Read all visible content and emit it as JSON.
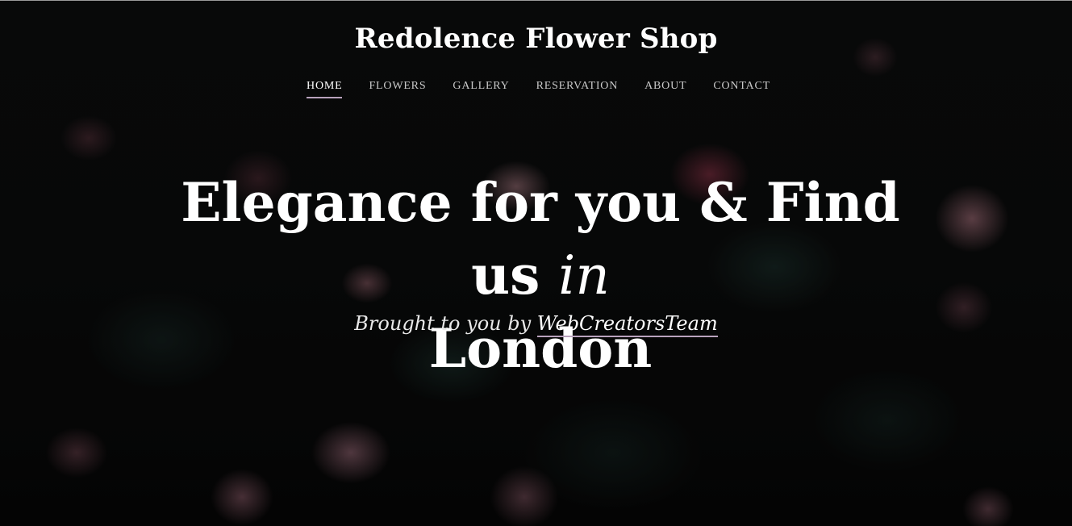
{
  "site": {
    "title": "Redolence Flower Shop"
  },
  "nav": {
    "items": [
      {
        "label": "HOME",
        "active": true
      },
      {
        "label": "FLOWERS",
        "active": false
      },
      {
        "label": "GALLERY",
        "active": false
      },
      {
        "label": "RESERVATION",
        "active": false
      },
      {
        "label": "ABOUT",
        "active": false
      },
      {
        "label": "CONTACT",
        "active": false
      }
    ]
  },
  "hero": {
    "headline_part1": "Elegance for you & Find us ",
    "headline_emphasis": "in",
    "headline_part2": "London",
    "byline_prefix": "Brought to you by ",
    "byline_link": "WebCreatorsTeam"
  },
  "colors": {
    "accent": "#b9a2bd",
    "text": "#ffffff",
    "nav_text": "#c9c9c9",
    "background": "#0a0b0b"
  }
}
